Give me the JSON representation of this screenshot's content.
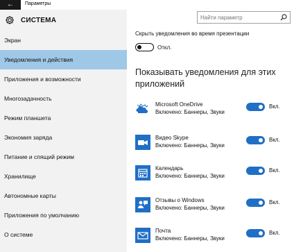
{
  "window": {
    "title": "Параметры",
    "back_glyph": "←"
  },
  "sidebar": {
    "title": "СИСТЕМА",
    "items": [
      {
        "label": "Экран",
        "active": false
      },
      {
        "label": "Уведомления и действия",
        "active": true
      },
      {
        "label": "Приложения и возможности",
        "active": false
      },
      {
        "label": "Многозадачность",
        "active": false
      },
      {
        "label": "Режим планшета",
        "active": false
      },
      {
        "label": "Экономия заряда",
        "active": false
      },
      {
        "label": "Питание и спящий режим",
        "active": false
      },
      {
        "label": "Хранилище",
        "active": false
      },
      {
        "label": "Автономные карты",
        "active": false
      },
      {
        "label": "Приложения по умолчанию",
        "active": false
      },
      {
        "label": "О системе",
        "active": false
      }
    ]
  },
  "search": {
    "placeholder": "Найти параметр",
    "icon": "search-icon"
  },
  "presentation": {
    "label": "Скрыть уведомления во время презентации",
    "state": "Откл.",
    "on": false
  },
  "apps_section": {
    "heading": "Показывать уведомления для этих приложений",
    "apps": [
      {
        "name": "Microsoft OneDrive",
        "status": "Включено: Баннеры, Звуки",
        "state": "Вкл.",
        "icon": "onedrive-icon",
        "color": "#1f6fc5"
      },
      {
        "name": "Видео Skype",
        "status": "Включено: Баннеры, Звуки",
        "state": "Вкл.",
        "icon": "skype-video-icon",
        "color": "#1f6fc5"
      },
      {
        "name": "Календарь",
        "status": "Включено: Баннеры, Звуки",
        "state": "Вкл.",
        "icon": "calendar-icon",
        "color": "#1f6fc5"
      },
      {
        "name": "Отзывы о Windows",
        "status": "Включено: Баннеры, Звуки",
        "state": "Вкл.",
        "icon": "feedback-icon",
        "color": "#1f6fc5"
      },
      {
        "name": "Почта",
        "status": "Включено: Баннеры, Звуки",
        "state": "Вкл.",
        "icon": "mail-icon",
        "color": "#1f6fc5"
      }
    ]
  },
  "colors": {
    "accent": "#1f6fc5",
    "nav_active": "#9fc8e7",
    "sidebar_bg": "#f2f2f2"
  }
}
